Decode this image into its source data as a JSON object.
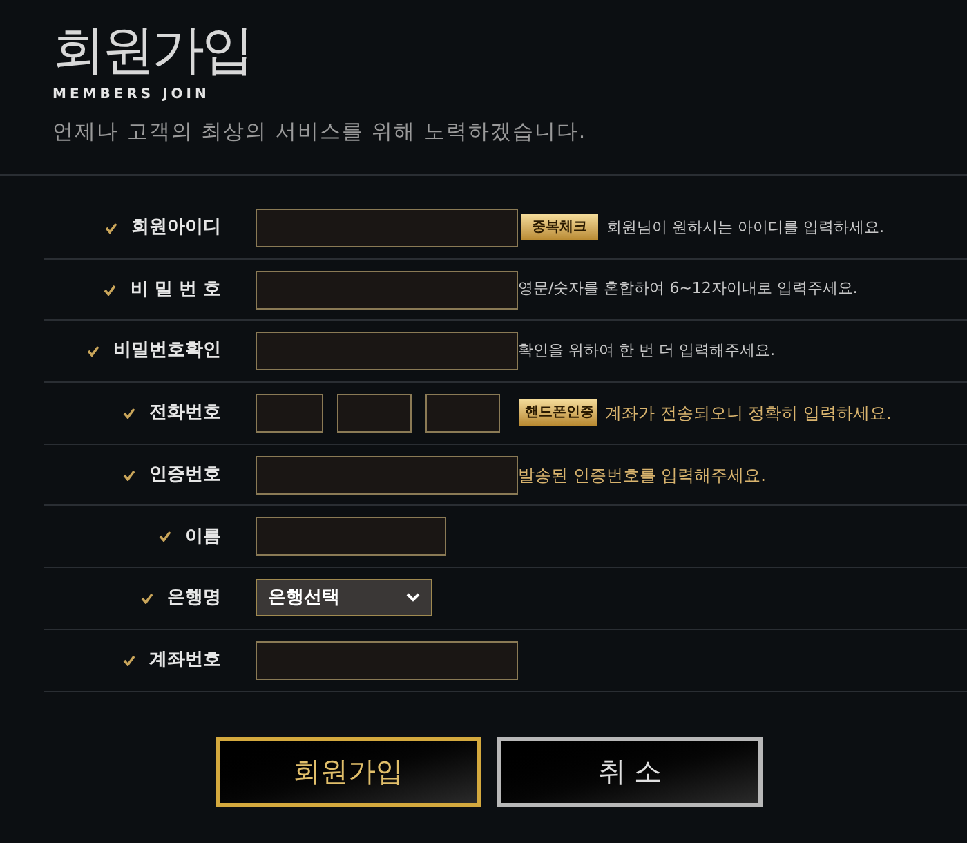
{
  "header": {
    "title": "회원가입",
    "subtitle": "MEMBERS JOIN",
    "tagline": "언제나 고객의 최상의 서비스를 위해 노력하겠습니다."
  },
  "rows": [
    {
      "kind": "text",
      "label": "회원아이디",
      "button": "중복체크",
      "hint": "회원님이 원하시는 아이디를 입력하세요.",
      "color": "#c8c8c8"
    },
    {
      "kind": "text",
      "label": "비 밀 번 호",
      "hint": "영문/숫자를 혼합하여 6~12자이내로 입력주세요.",
      "color": "#c8c8c8"
    },
    {
      "kind": "text",
      "label": "비밀번호확인",
      "hint": "확인을 위하여 한 번 더 입력해주세요.",
      "color": "#c8c8c8"
    },
    {
      "kind": "phone",
      "label": "전화번호",
      "button": "핸드폰인증",
      "hint": "계좌가 전송되오니 정확히 입력하세요.",
      "color": "#d9b46e"
    },
    {
      "kind": "text",
      "label": "인증번호",
      "hint": "발송된 인증번호를 입력해주세요.",
      "color": "#d9b46e"
    },
    {
      "kind": "short",
      "label": "이름"
    },
    {
      "kind": "select",
      "label": "은행명",
      "value": "은행선택"
    },
    {
      "kind": "text",
      "label": "계좌번호"
    }
  ],
  "actions": [
    {
      "kind": "gold",
      "label": "회원가입"
    },
    {
      "kind": "silver",
      "label": "취 소"
    }
  ]
}
